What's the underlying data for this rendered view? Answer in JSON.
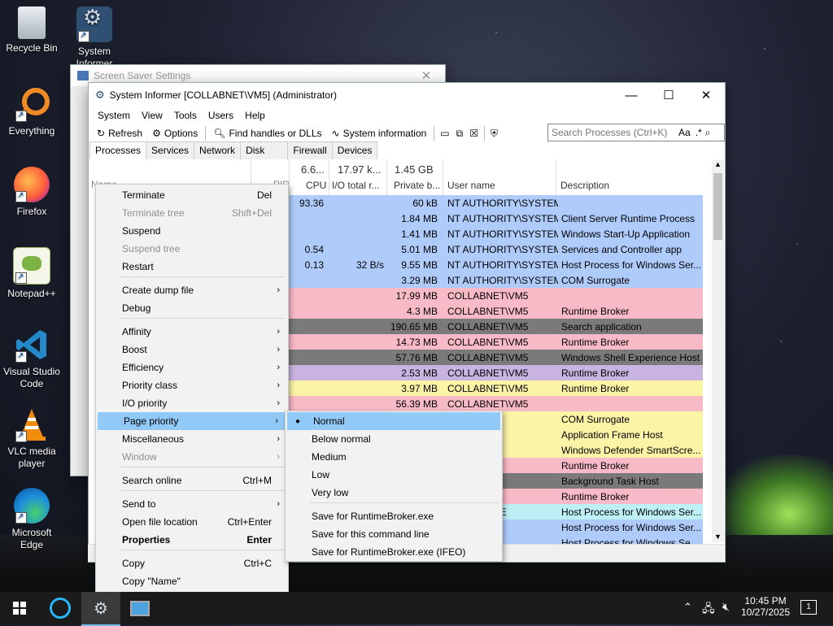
{
  "desktop": {
    "icons": [
      {
        "label": "Recycle Bin"
      },
      {
        "label": "System Informer"
      },
      {
        "label": "Everything"
      },
      {
        "label": "Firefox"
      },
      {
        "label": "Notepad++"
      },
      {
        "label": "Visual Studio Code"
      },
      {
        "label": "VLC media player"
      },
      {
        "label": "Microsoft Edge"
      }
    ]
  },
  "screensaver_window": {
    "title": "Screen Saver Settings"
  },
  "main_window": {
    "title": "System Informer [COLLABNET\\VM5] (Administrator)",
    "menu": [
      "System",
      "View",
      "Tools",
      "Users",
      "Help"
    ],
    "toolbar": {
      "refresh": "Refresh",
      "options": "Options",
      "find": "Find handles or DLLs",
      "sysinfo": "System information",
      "search_placeholder": "Search Processes (Ctrl+K)",
      "case_toggle": "Aa",
      "regex_toggle": ".*"
    },
    "tabs": [
      "Processes",
      "Services",
      "Network",
      "Disk",
      "Firewall",
      "Devices"
    ],
    "header": {
      "pid_fragment": "PID",
      "name_fragment": "Name",
      "cpu_total": "6.6...",
      "io_total": "17.97 k...",
      "private_total": "1.45 GB",
      "cpu": "CPU",
      "io": "I/O total r...",
      "private": "Private b...",
      "user": "User name",
      "desc": "Description"
    },
    "rows": [
      {
        "cpu": "93.36",
        "io": "",
        "priv": "60 kB",
        "user": "NT AUTHORITY\\SYSTEM",
        "desc": "",
        "color": "#aecbfa"
      },
      {
        "cpu": "",
        "io": "",
        "priv": "1.84 MB",
        "user": "NT AUTHORITY\\SYSTEM",
        "desc": "Client Server Runtime Process",
        "color": "#aecbfa"
      },
      {
        "cpu": "",
        "io": "",
        "priv": "1.41 MB",
        "user": "NT AUTHORITY\\SYSTEM",
        "desc": "Windows Start-Up Application",
        "color": "#aecbfa"
      },
      {
        "cpu": "0.54",
        "io": "",
        "priv": "5.01 MB",
        "user": "NT AUTHORITY\\SYSTEM",
        "desc": "Services and Controller app",
        "color": "#aecbfa"
      },
      {
        "cpu": "0.13",
        "io": "32 B/s",
        "priv": "9.55 MB",
        "user": "NT AUTHORITY\\SYSTEM",
        "desc": "Host Process for Windows Ser...",
        "color": "#aecbfa"
      },
      {
        "cpu": "",
        "io": "",
        "priv": "3.29 MB",
        "user": "NT AUTHORITY\\SYSTEM",
        "desc": "COM Surrogate",
        "color": "#aecbfa"
      },
      {
        "cpu": "",
        "io": "",
        "priv": "17.99 MB",
        "user": "COLLABNET\\VM5",
        "desc": "",
        "color": "#f8bac6"
      },
      {
        "cpu": "",
        "io": "",
        "priv": "4.3 MB",
        "user": "COLLABNET\\VM5",
        "desc": "Runtime Broker",
        "color": "#f8bac6"
      },
      {
        "cpu": "",
        "io": "",
        "priv": "190.65 MB",
        "user": "COLLABNET\\VM5",
        "desc": "Search application",
        "color": "#7a7a7a"
      },
      {
        "cpu": "",
        "io": "",
        "priv": "14.73 MB",
        "user": "COLLABNET\\VM5",
        "desc": "Runtime Broker",
        "color": "#f8bac6"
      },
      {
        "cpu": "",
        "io": "",
        "priv": "57.76 MB",
        "user": "COLLABNET\\VM5",
        "desc": "Windows Shell Experience Host",
        "color": "#7a7a7a"
      },
      {
        "cpu": "",
        "io": "",
        "priv": "2.53 MB",
        "user": "COLLABNET\\VM5",
        "desc": "Runtime Broker",
        "color": "#c9b3e0"
      },
      {
        "cpu": "",
        "io": "",
        "priv": "3.97 MB",
        "user": "COLLABNET\\VM5",
        "desc": "Runtime Broker",
        "color": "#fbf3a6"
      },
      {
        "cpu": "",
        "io": "",
        "priv": "56.39 MB",
        "user": "COLLABNET\\VM5",
        "desc": "",
        "color": "#f8bac6"
      },
      {
        "cpu": "",
        "io": "",
        "priv": "",
        "user": "\\VM5",
        "desc": "COM Surrogate",
        "color": "#fbf3a6"
      },
      {
        "cpu": "",
        "io": "",
        "priv": "",
        "user": "\\VM5",
        "desc": "Application Frame Host",
        "color": "#fbf3a6"
      },
      {
        "cpu": "",
        "io": "",
        "priv": "",
        "user": "\\VM5",
        "desc": "Windows Defender SmartScre...",
        "color": "#fbf3a6"
      },
      {
        "cpu": "",
        "io": "",
        "priv": "",
        "user": "\\VM5",
        "desc": "Runtime Broker",
        "color": "#f8bac6"
      },
      {
        "cpu": "",
        "io": "",
        "priv": "",
        "user": "\\VM5",
        "desc": "Background Task Host",
        "color": "#7a7a7a"
      },
      {
        "cpu": "",
        "io": "",
        "priv": "",
        "user": "\\VM5",
        "desc": "Runtime Broker",
        "color": "#f8bac6"
      },
      {
        "cpu": "",
        "io": "",
        "priv": "",
        "user": "RK SERVICE",
        "desc": "Host Process for Windows Ser...",
        "color": "#bdf0f5"
      },
      {
        "cpu": "",
        "io": "",
        "priv": "",
        "user": "Y\\SYSTEM",
        "desc": "Host Process for Windows Ser...",
        "color": "#aecbfa"
      },
      {
        "cpu": "",
        "io": "",
        "priv": "",
        "user": "Y\\SYSTEM",
        "desc": "Host Process for Windows Se...",
        "color": "#aecbfa"
      }
    ]
  },
  "context_menu": {
    "items": [
      {
        "label": "Terminate",
        "shortcut": "Del"
      },
      {
        "label": "Terminate tree",
        "shortcut": "Shift+Del",
        "disabled": true
      },
      {
        "label": "Suspend"
      },
      {
        "label": "Suspend tree",
        "disabled": true
      },
      {
        "label": "Restart"
      },
      {
        "label": "Create dump file",
        "submenu": true
      },
      {
        "label": "Debug"
      },
      {
        "label": "Affinity",
        "submenu": true
      },
      {
        "label": "Boost",
        "submenu": true
      },
      {
        "label": "Efficiency",
        "submenu": true
      },
      {
        "label": "Priority class",
        "submenu": true
      },
      {
        "label": "I/O priority",
        "submenu": true
      },
      {
        "label": "Page priority",
        "submenu": true,
        "highlighted": true
      },
      {
        "label": "Miscellaneous",
        "submenu": true
      },
      {
        "label": "Window",
        "submenu": true,
        "disabled": true
      },
      {
        "label": "Search online",
        "shortcut": "Ctrl+M"
      },
      {
        "label": "Send to",
        "submenu": true
      },
      {
        "label": "Open file location",
        "shortcut": "Ctrl+Enter"
      },
      {
        "label": "Properties",
        "shortcut": "Enter",
        "bold": true
      },
      {
        "label": "Copy",
        "shortcut": "Ctrl+C"
      },
      {
        "label": "Copy \"Name\""
      }
    ]
  },
  "submenu": {
    "items": [
      {
        "label": "Normal",
        "checked": true
      },
      {
        "label": "Below normal"
      },
      {
        "label": "Medium"
      },
      {
        "label": "Low"
      },
      {
        "label": "Very low"
      },
      {
        "label": "Save for RuntimeBroker.exe"
      },
      {
        "label": "Save for this command line"
      },
      {
        "label": "Save for RuntimeBroker.exe (IFEO)"
      }
    ]
  },
  "taskbar": {
    "time": "10:45 PM",
    "date": "10/27/2025",
    "notification_count": "1"
  },
  "colors": {
    "menu_highlight": "#91c9f7",
    "service_row": "#aecbfa",
    "user_row": "#f8bac6",
    "suspended_row": "#7a7a7a"
  }
}
